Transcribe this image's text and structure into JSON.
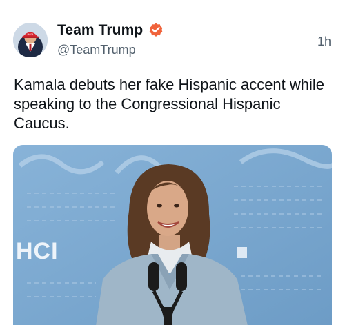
{
  "post": {
    "author": {
      "display_name": "Team Trump",
      "handle": "@TeamTrump",
      "verified": true,
      "avatar_icon": "profile-photo-avatar",
      "verified_icon": "verified-badge-icon",
      "verified_color": "#f0633b"
    },
    "timestamp": "1h",
    "text": "Kamala debuts her fake Hispanic accent while speaking to the Congressional Hispanic Caucus.",
    "media": {
      "kind": "photo",
      "backdrop_text": "HCI",
      "backdrop_color": "#7aa7cf"
    }
  }
}
